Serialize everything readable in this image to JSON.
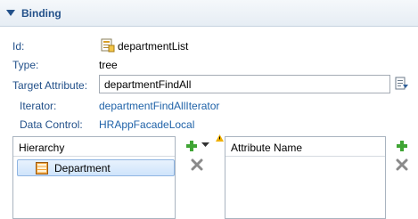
{
  "section": {
    "title": "Binding"
  },
  "fields": {
    "id_label": "Id:",
    "id_value": "departmentList",
    "type_label": "Type:",
    "type_value": "tree",
    "target_label": "Target Attribute:",
    "target_value": "departmentFindAll",
    "iterator_label": "Iterator:",
    "iterator_value": "departmentFindAllIterator",
    "data_control_label": "Data Control:",
    "data_control_value": "HRAppFacadeLocal"
  },
  "hierarchy": {
    "header": "Hierarchy",
    "items": [
      {
        "label": "Department"
      }
    ]
  },
  "attributes": {
    "header": "Attribute Name"
  },
  "icons": {
    "section_toggle": "chevron-down-icon",
    "id_icon": "binding-icon",
    "target_browse": "browse-icon",
    "add": "add-icon",
    "add_menu": "dropdown-arrow-icon",
    "delete": "delete-icon",
    "warning": "warning-icon",
    "tree_item": "table-icon"
  },
  "colors": {
    "label": "#23518a",
    "link": "#1f62a8",
    "add_green": "#3fa534",
    "delete_gray": "#8a8a8a",
    "warning": "#f0b000"
  }
}
